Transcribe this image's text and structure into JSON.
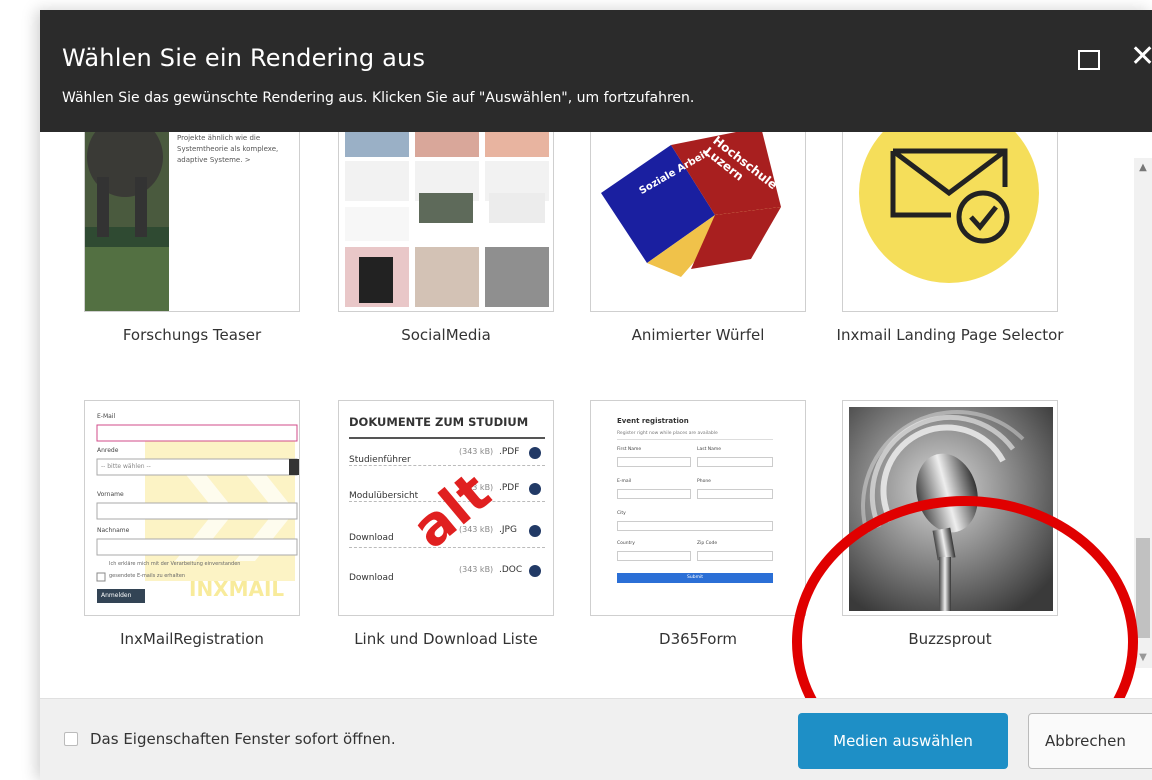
{
  "dialog": {
    "title": "Wählen Sie ein Rendering aus",
    "subtitle": "Wählen Sie das gewünschte Rendering aus. Klicken Sie auf \"Auswählen\", um fortzufahren.",
    "maximize_icon": "maximize-icon",
    "close_label": "✕"
  },
  "renderings": [
    {
      "label": "Forschungs Teaser",
      "thumb_text": "Projekte ähnlich wie die Systemtheorie als komplexe, adaptive Systeme. >"
    },
    {
      "label": "SocialMedia"
    },
    {
      "label": "Animierter Würfel",
      "cube_text_a": "Soziale Arbeit",
      "cube_text_b": "Hochschule Luzern"
    },
    {
      "label": "Inxmail Landing Page Selector"
    },
    {
      "label": "InxMailRegistration",
      "thumb_fields": [
        "E-Mail",
        "Anrede",
        "-- bitte wählen --",
        "Vorname",
        "Nachname",
        "Ich erkläre mich mit der Verarbeitung einverstanden",
        "gesendete E-mails zu erhalten",
        "Anmelden"
      ],
      "watermark": "INXMAIL"
    },
    {
      "label": "Link und Download Liste",
      "thumb_title": "DOKUMENTE ZUM STUDIUM",
      "thumb_rows": [
        {
          "name": "Studienführer",
          "size": "(343 kB)",
          "type": ".PDF"
        },
        {
          "name": "Modulübersicht",
          "size": "(343 kB)",
          "type": ".PDF"
        },
        {
          "name": "Download",
          "size": "(343 kB)",
          "type": ".JPG"
        },
        {
          "name": "Download",
          "size": "(343 kB)",
          "type": ".DOC"
        }
      ],
      "overlay": "alt"
    },
    {
      "label": "D365Form",
      "thumb_title": "Event registration",
      "thumb_sub": "Register right now while places are available",
      "thumb_fields": [
        "First Name",
        "Last Name",
        "E-mail",
        "Phone",
        "City",
        "Country",
        "Zip Code"
      ],
      "thumb_button": "Submit"
    },
    {
      "label": "Buzzsprout"
    }
  ],
  "footer": {
    "checkbox_label": "Das Eigenschaften Fenster sofort öffnen.",
    "primary_button": "Medien auswählen",
    "cancel_button": "Abbrechen"
  },
  "colors": {
    "header_bg": "#2b2b2b",
    "primary": "#1e8fc6",
    "annotation": "#e00000",
    "inxmail_yellow": "#f5de5a"
  }
}
